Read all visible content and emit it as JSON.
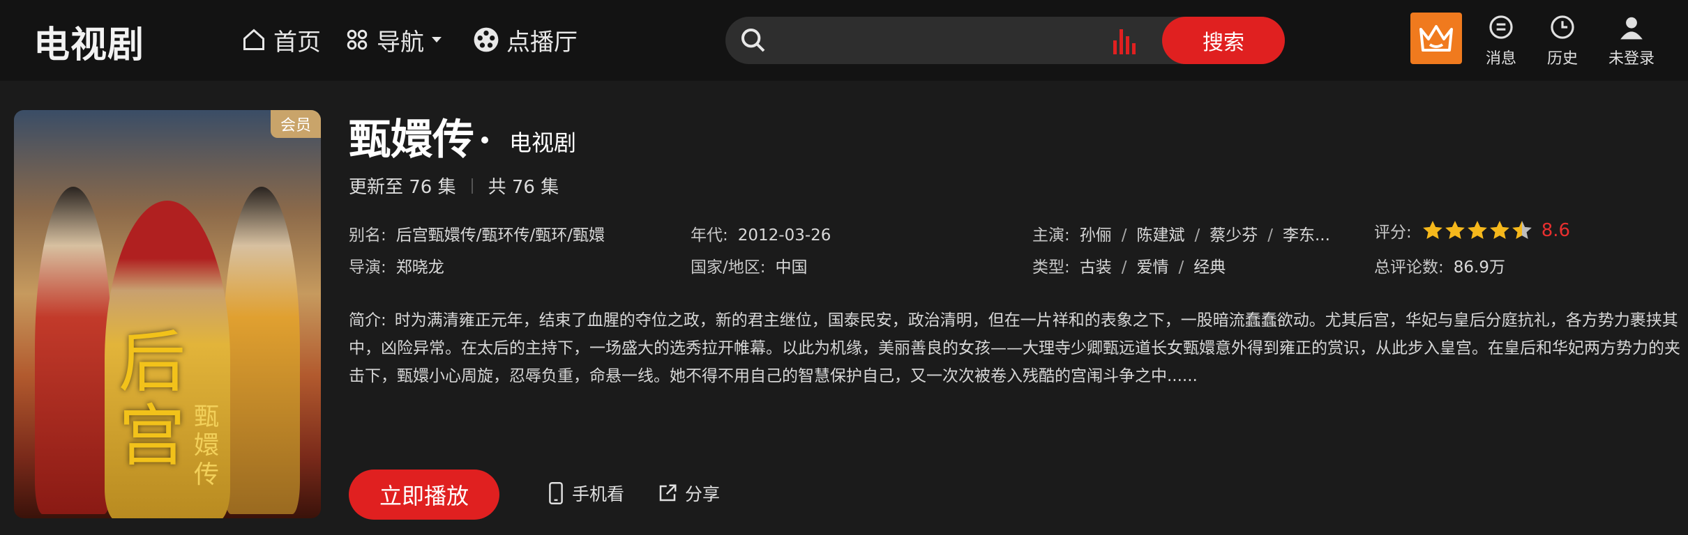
{
  "header": {
    "site_title": "电视剧",
    "nav": [
      {
        "label": "首页",
        "icon": "home-icon"
      },
      {
        "label": "导航",
        "icon": "grid-icon"
      },
      {
        "label": "点播厅",
        "icon": "film-reel-icon"
      }
    ],
    "search": {
      "placeholder": "",
      "button_label": "搜索"
    },
    "tools": [
      {
        "label": "消息",
        "icon": "message-icon"
      },
      {
        "label": "历史",
        "icon": "clock-icon"
      },
      {
        "label": "未登录",
        "icon": "user-icon"
      }
    ],
    "vip_icon": "crown-icon"
  },
  "show": {
    "poster_badge": "会员",
    "poster_calligraphy": "后宫",
    "poster_subtitle": "甄嬛传",
    "title": "甄嬛传",
    "category": "电视剧",
    "updated_to": "更新至 76 集",
    "total": "共 76 集",
    "alias_label": "别名:",
    "alias_value": "后宫甄嬛传/甄环传/甄环/甄嬛",
    "director_label": "导演:",
    "director_value": "郑晓龙",
    "year_label": "年代:",
    "year_value": "2012-03-26",
    "region_label": "国家/地区:",
    "region_value": "中国",
    "cast_label": "主演:",
    "cast": [
      "孙俪",
      "陈建斌",
      "蔡少芬",
      "李东..."
    ],
    "genre_label": "类型:",
    "genres": [
      "古装",
      "爱情",
      "经典"
    ],
    "rating_label": "评分:",
    "rating_stars": 4.5,
    "rating_score": "8.6",
    "reviews_label": "总评论数:",
    "reviews_value": "86.9万",
    "summary_label": "简介:",
    "summary": "时为满清雍正元年，结束了血腥的夺位之政，新的君主继位，国泰民安，政治清明，但在一片祥和的表象之下，一股暗流蠢蠢欲动。尤其后宫，华妃与皇后分庭抗礼，各方势力裹挟其中，凶险异常。在太后的主持下，一场盛大的选秀拉开帷幕。以此为机缘，美丽善良的女孩——大理寺少卿甄远道长女甄嬛意外得到雍正的赏识，从此步入皇宫。在皇后和华妃两方势力的夹击下，甄嬛小心周旋，忍辱负重，命悬一线。她不得不用自己的智慧保护自己，又一次次被卷入残酷的宫闱斗争之中......",
    "play_label": "立即播放",
    "mobile_label": "手机看",
    "share_label": "分享"
  },
  "colors": {
    "accent": "#e02020",
    "vip": "#f07a1e",
    "star": "#f5b81c",
    "score": "#e82f2f"
  }
}
